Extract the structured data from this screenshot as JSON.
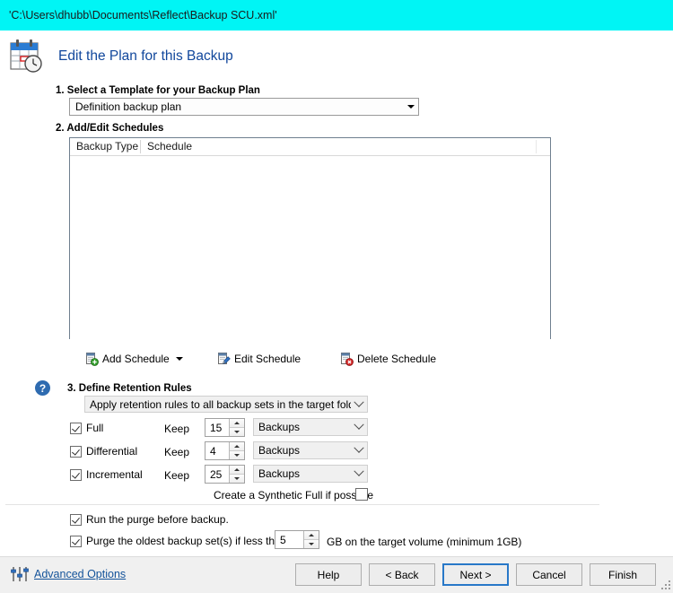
{
  "window": {
    "titlebar_text": "'C:\\Users\\dhubb\\Documents\\Reflect\\Backup SCU.xml'",
    "titlebar_color": "#00f5f5"
  },
  "header": {
    "icon": "calendar-clock-icon",
    "title": "Edit the Plan for this Backup",
    "title_color": "#11479c"
  },
  "step1": {
    "label": "1. Select a Template for your Backup Plan",
    "template_select": {
      "value": "Definition backup plan",
      "icon": "chevron-down-icon"
    }
  },
  "step2": {
    "label": "2. Add/Edit Schedules",
    "columns": [
      "Backup Type",
      "Schedule"
    ],
    "rows": [],
    "toolbar": {
      "add": {
        "label": "Add Schedule",
        "icon": "add-schedule-icon",
        "dropdown_icon": "triangle-down-icon"
      },
      "edit": {
        "label": "Edit Schedule",
        "icon": "edit-schedule-icon"
      },
      "delete": {
        "label": "Delete Schedule",
        "icon": "delete-schedule-icon"
      }
    }
  },
  "step3": {
    "help_icon": "help-question-icon",
    "label": "3. Define Retention Rules",
    "scope_select": {
      "value": "Apply retention rules to all backup sets in the target folder",
      "icon": "chevron-down-icon"
    },
    "keep_label": "Keep",
    "rules": [
      {
        "name": "Full",
        "checked": true,
        "keep_label": "Keep",
        "value": "15",
        "unit": "Backups"
      },
      {
        "name": "Differential",
        "checked": true,
        "keep_label": "Keep",
        "value": "4",
        "unit": "Backups"
      },
      {
        "name": "Incremental",
        "checked": true,
        "keep_label": "Keep",
        "value": "25",
        "unit": "Backups"
      }
    ],
    "synthetic_full": {
      "label": "Create a Synthetic Full if possible",
      "checked": false
    }
  },
  "purge": {
    "run_before": {
      "label": "Run the purge before backup.",
      "checked": true
    },
    "oldest": {
      "label_before": "Purge the oldest backup set(s) if less than",
      "value": "5",
      "label_after": "GB on the target volume (minimum 1GB)",
      "checked": true
    }
  },
  "footer": {
    "advanced_options": {
      "label": "Advanced Options",
      "icon": "sliders-icon",
      "color": "#14539a"
    },
    "buttons": [
      {
        "label": "Help",
        "default": false
      },
      {
        "label": "< Back",
        "default": false
      },
      {
        "label": "Next >",
        "default": true
      },
      {
        "label": "Cancel",
        "default": false
      },
      {
        "label": "Finish",
        "default": false
      }
    ],
    "resize_grip": "resize-grip-icon"
  }
}
